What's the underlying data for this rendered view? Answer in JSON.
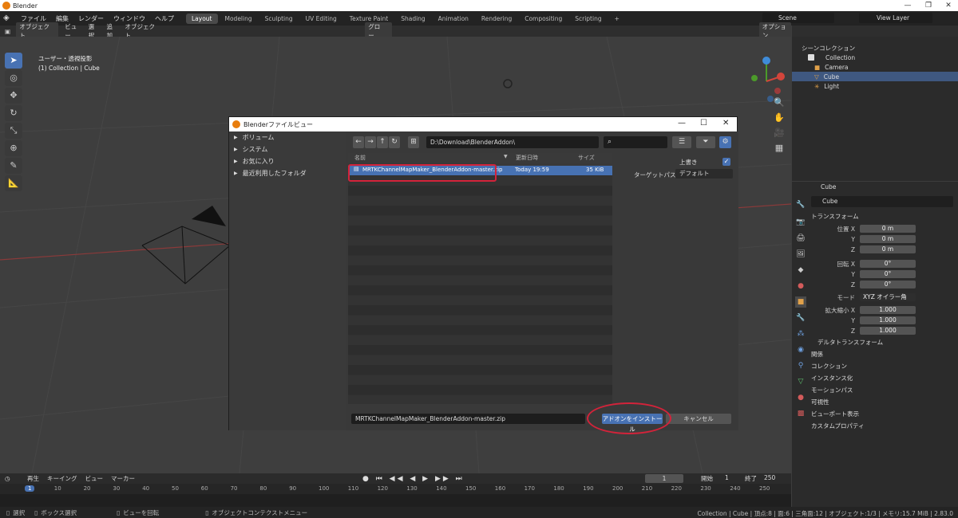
{
  "window": {
    "title": "Blender",
    "min": "—",
    "max": "❐",
    "close": "✕"
  },
  "menu": {
    "items": [
      "ファイル",
      "編集",
      "レンダー",
      "ウィンドウ",
      "ヘルプ"
    ]
  },
  "workspaces": [
    "Layout",
    "Modeling",
    "Sculpting",
    "UV Editing",
    "Texture Paint",
    "Shading",
    "Animation",
    "Rendering",
    "Compositing",
    "Scripting"
  ],
  "add_ws": "+",
  "scene": {
    "label": "Scene",
    "view_layer": "View Layer"
  },
  "header": {
    "mode": "オブジェクト...",
    "view": "ビュー",
    "select": "選択",
    "add": "追加",
    "object": "オブジェクト",
    "transform": "グロー...",
    "options": "オプション"
  },
  "viewport": {
    "view_name": "ユーザー・透視投影",
    "collection_info": "(1) Collection | Cube"
  },
  "outliner": {
    "title": "シーンコレクション",
    "items": [
      {
        "label": "Collection"
      },
      {
        "label": "Camera"
      },
      {
        "label": "Cube"
      },
      {
        "label": "Light"
      }
    ]
  },
  "properties": {
    "object_name": "Cube",
    "data_name": "Cube",
    "transform_title": "トランスフォーム",
    "location": {
      "label": "位置 X",
      "x": "0 m",
      "y": "0 m",
      "z": "0 m"
    },
    "rotation": {
      "label": "回転 X",
      "x": "0°",
      "y": "0°",
      "z": "0°"
    },
    "mode": {
      "label": "モード",
      "value": "XYZ オイラー角"
    },
    "scale": {
      "label": "拡大縮小 X",
      "x": "1.000",
      "y": "1.000",
      "z": "1.000"
    },
    "axis_y": "Y",
    "axis_z": "Z",
    "delta": "デルタトランスフォーム",
    "sections": [
      "関係",
      "コレクション",
      "インスタンス化",
      "モーションパス",
      "可視性",
      "ビューポート表示",
      "カスタムプロパティ"
    ]
  },
  "timeline": {
    "playback": "再生",
    "keying": "キーイング",
    "view": "ビュー",
    "marker": "マーカー",
    "current_frame": "1",
    "start_label": "開始",
    "start": "1",
    "end_label": "終了",
    "end": "250",
    "ticks": [
      "1",
      "10",
      "20",
      "30",
      "40",
      "50",
      "60",
      "70",
      "80",
      "90",
      "100",
      "110",
      "120",
      "130",
      "140",
      "150",
      "160",
      "170",
      "180",
      "190",
      "200",
      "210",
      "220",
      "230",
      "240",
      "250"
    ]
  },
  "status": {
    "select": "選択",
    "box_select": "ボックス選択",
    "rotate": "ビューを回転",
    "context": "オブジェクトコンテクストメニュー",
    "info": "Collection | Cube | 頂点:8 | 面:6 | 三角面:12 | オブジェクト:1/3 | メモリ:15.7 MiB | 2.83.0"
  },
  "dialog": {
    "title": "Blenderファイルビュー",
    "categories": [
      "ボリューム",
      "システム",
      "お気に入り",
      "最近利用したフォルダ"
    ],
    "path": "D:\\Download\\BlenderAddon\\",
    "columns": {
      "name": "名前",
      "date": "更新日時",
      "size": "サイズ"
    },
    "files": [
      {
        "name": "MRTKChannelMapMaker_BlenderAddon-master.zip",
        "date": "Today 19:59",
        "size": "35 KiB"
      }
    ],
    "overwrite": "上書き",
    "target_path_label": "ターゲットパス",
    "target_path_value": "デフォルト",
    "filename": "MRTKChannelMapMaker_BlenderAddon-master.zip",
    "install": "アドオンをインストール",
    "cancel": "キャンセル"
  },
  "colors": {
    "accent": "#4872b3",
    "highlight": "#d3233a",
    "selected_row": "#3f5880"
  }
}
